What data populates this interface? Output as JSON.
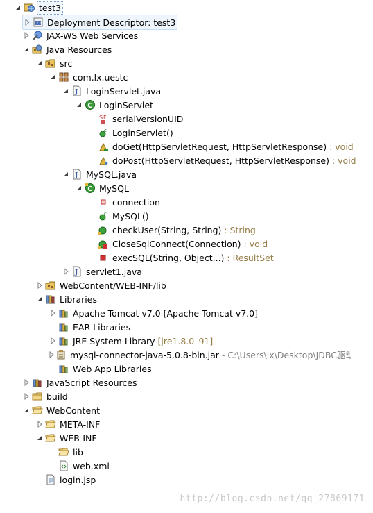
{
  "tree": {
    "items": [
      {
        "label": "test3",
        "icon": "web-project-icon"
      },
      {
        "label": "Deployment Descriptor: test3",
        "icon": "deployment-descriptor-icon"
      },
      {
        "label": "JAX-WS Web Services",
        "icon": "web-services-icon"
      },
      {
        "label": "Java Resources",
        "icon": "java-resources-icon"
      },
      {
        "label": "src",
        "icon": "source-folder-icon"
      },
      {
        "label": "com.lx.uestc",
        "icon": "package-icon"
      },
      {
        "label": "LoginServlet.java",
        "icon": "java-file-icon"
      },
      {
        "label": "LoginServlet",
        "icon": "class-icon"
      },
      {
        "label": "serialVersionUID",
        "icon": "static-final-field-icon"
      },
      {
        "label": "LoginServlet()",
        "icon": "constructor-icon"
      },
      {
        "label": "doGet(HttpServletRequest, HttpServletResponse)",
        "decoration": " : void",
        "icon": "protected-method-icon"
      },
      {
        "label": "doPost(HttpServletRequest, HttpServletResponse)",
        "decoration": " : void",
        "icon": "protected-override-method-icon"
      },
      {
        "label": "MySQL.java",
        "icon": "java-file-icon"
      },
      {
        "label": "MySQL",
        "icon": "class-icon"
      },
      {
        "label": "connection",
        "icon": "private-field-icon"
      },
      {
        "label": "MySQL()",
        "icon": "constructor-icon"
      },
      {
        "label": "checkUser(String, String)",
        "decoration": " : String",
        "icon": "public-method-icon"
      },
      {
        "label": "CloseSqlConnect(Connection)",
        "decoration": " : void",
        "icon": "public-method-icon"
      },
      {
        "label": "execSQL(String, Object...)",
        "decoration": " : ResultSet",
        "icon": "private-method-icon"
      },
      {
        "label": "servlet1.java",
        "icon": "java-file-icon"
      },
      {
        "label": "WebContent/WEB-INF/lib",
        "icon": "library-folder-icon"
      },
      {
        "label": "Libraries",
        "icon": "libraries-icon"
      },
      {
        "label": "Apache Tomcat v7.0 [Apache Tomcat v7.0]",
        "icon": "library-icon"
      },
      {
        "label": "EAR Libraries",
        "icon": "library-icon"
      },
      {
        "label": "JRE System Library",
        "decoration": " [jre1.8.0_91]",
        "icon": "library-icon"
      },
      {
        "label": "mysql-connector-java-5.0.8-bin.jar",
        "decoration": " - C:\\Users\\lx\\Desktop\\JDBC驱动\\m",
        "icon": "jar-icon"
      },
      {
        "label": "Web App Libraries",
        "icon": "library-icon"
      },
      {
        "label": "JavaScript Resources",
        "icon": "javascript-resources-icon"
      },
      {
        "label": "build",
        "icon": "folder-icon"
      },
      {
        "label": "WebContent",
        "icon": "folder-icon"
      },
      {
        "label": "META-INF",
        "icon": "folder-icon"
      },
      {
        "label": "WEB-INF",
        "icon": "folder-icon"
      },
      {
        "label": "lib",
        "icon": "folder-icon"
      },
      {
        "label": "web.xml",
        "icon": "xml-file-icon"
      },
      {
        "label": "login.jsp",
        "icon": "jsp-file-icon"
      }
    ]
  },
  "watermark": "http://blog.csdn.net/qq_27869171"
}
